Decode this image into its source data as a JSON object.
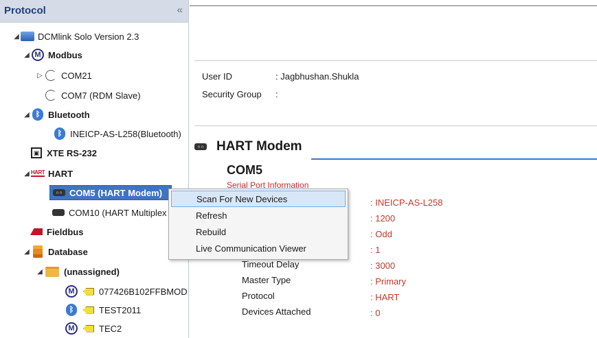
{
  "panel": {
    "title": "Protocol",
    "collapse_glyph": "«"
  },
  "tree": {
    "root": "DCMlink Solo Version 2.3",
    "modbus": "Modbus",
    "com21": "COM21",
    "com7": "COM7 (RDM Slave)",
    "bluetooth": "Bluetooth",
    "bt_device": "INEICP-AS-L258(Bluetooth)",
    "xte": "XTE RS-232",
    "hart": "HART",
    "com5": "COM5 (HART Modem)",
    "com10": "COM10 (HART Multiplex",
    "fieldbus": "Fieldbus",
    "database": "Database",
    "unassigned": "(unassigned)",
    "dev1": "077426B102FFBMOD",
    "dev2": "TEST2011",
    "dev3": "TEC2",
    "glyphs": {
      "expanded": "◢",
      "collapsed": "▷",
      "m": "M",
      "bt": "ᛒ",
      "xte": "▣",
      "hart": "HART",
      "modem": "∩∩"
    }
  },
  "user": {
    "user_id_label": "User ID",
    "user_id_value": ": Jagbhushan.Shukla",
    "security_label": "Security Group",
    "security_value": ":"
  },
  "section": {
    "title": "HART Modem",
    "port": "COM5",
    "subtitle": "Serial Port Information"
  },
  "properties": {
    "timeout_label": "Timeout Delay",
    "master_label": "Master Type",
    "protocol_label": "Protocol",
    "devices_label": "Devices Attached",
    "values": [
      ": INEICP-AS-L258",
      ": 1200",
      ": Odd",
      ": 1",
      ": 3000",
      ": Primary",
      ": HART",
      ": 0"
    ]
  },
  "context_menu": {
    "items": [
      "Scan For New Devices",
      "Refresh",
      "Rebuild",
      "Live Communication Viewer"
    ],
    "highlighted": "Scan For New Devices"
  },
  "icons": [
    "collapse-icon",
    "computer-icon",
    "modbus-icon",
    "plug-icon",
    "bluetooth-icon",
    "xte-icon",
    "hart-icon",
    "modem-icon",
    "multiplexer-icon",
    "fieldbus-icon",
    "database-icon",
    "folder-icon",
    "tag-icon"
  ],
  "colors": {
    "selection": "#3f74c2",
    "menu_highlight": "#d8e7f7",
    "value_red": "#c0392b",
    "header_bg": "#d5dce8"
  }
}
